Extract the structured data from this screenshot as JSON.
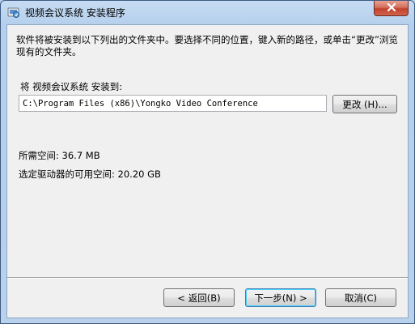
{
  "window": {
    "title": "视频会议系统 安装程序",
    "icon": "installer-icon",
    "close_icon": "close-icon"
  },
  "content": {
    "description": "软件将被安装到以下列出的文件夹中。要选择不同的位置，键入新的路径，或单击“更改”浏览现有的文件夹。",
    "install_to_label": "将 视频会议系统 安装到:",
    "install_path": "C:\\Program Files (x86)\\Yongko Video Conference",
    "browse_button": "更改 (H)...",
    "space_required": "所需空间: 36.7 MB",
    "space_available": "选定驱动器的可用空间: 20.20 GB"
  },
  "footer": {
    "back_button": "< 返回(B)",
    "next_button": "下一步(N) >",
    "cancel_button": "取消(C)"
  },
  "colors": {
    "frame": "#b9d1ec",
    "client_bg": "#f0f0f0",
    "close_button": "#c7513e",
    "default_button_border": "#3c7fb1"
  }
}
